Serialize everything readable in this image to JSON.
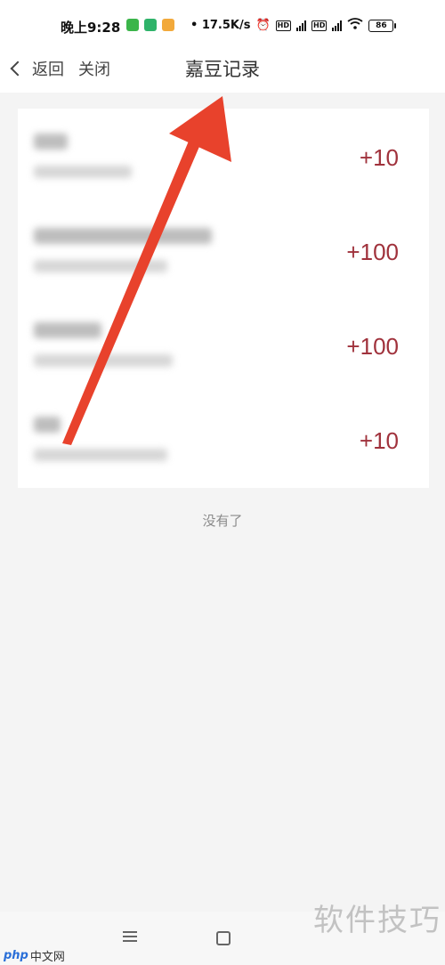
{
  "status_bar": {
    "time": "晚上9:28",
    "network_speed": "• 17.5K/s",
    "hd_label": "HD",
    "battery": "86",
    "badge_colors": [
      "#3bb54a",
      "#2fb36a",
      "#f2a93b"
    ]
  },
  "nav": {
    "back_label": "返回",
    "close_label": "关闭",
    "title": "嘉豆记录"
  },
  "records": [
    {
      "amount": "+10"
    },
    {
      "amount": "+100"
    },
    {
      "amount": "+100"
    },
    {
      "amount": "+10"
    }
  ],
  "footer": {
    "no_more": "没有了"
  },
  "watermark": {
    "right": "软件技巧",
    "left_logo": "php",
    "left_text": "中文网"
  },
  "accent_color": "#a0323c",
  "arrow_color": "#e8422c"
}
